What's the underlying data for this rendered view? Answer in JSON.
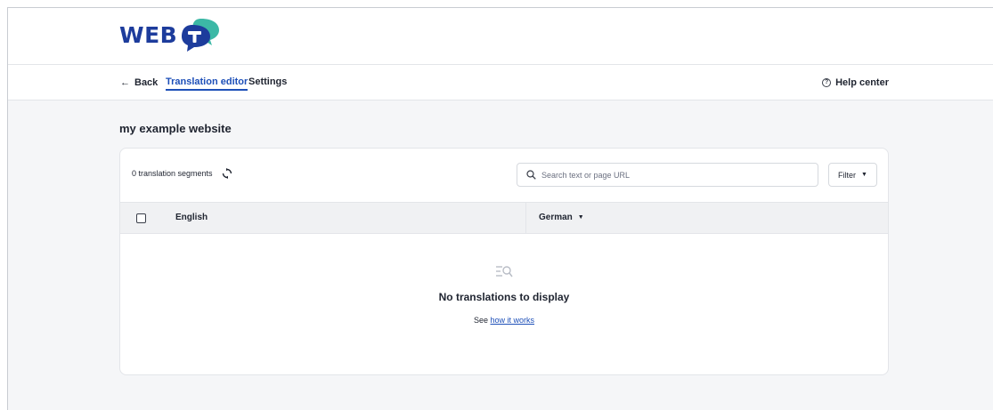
{
  "logo": {
    "text": "WEB",
    "mark_letter": "T",
    "brand_color": "#1d3c9c",
    "accent_color": "#3cb8a6"
  },
  "nav": {
    "back_label": "Back",
    "tabs": [
      {
        "label": "Translation editor",
        "active": true
      },
      {
        "label": "Settings",
        "active": false
      }
    ],
    "help_label": "Help center"
  },
  "page": {
    "title": "my example website"
  },
  "toolbar": {
    "segment_count": "0 translation segments",
    "search_placeholder": "Search text or page URL",
    "filter_label": "Filter"
  },
  "table": {
    "columns": [
      {
        "label": "English"
      },
      {
        "label": "German"
      }
    ]
  },
  "empty_state": {
    "title": "No translations to display",
    "see_text": "See",
    "link_text": "how it works"
  },
  "icons": {
    "back": "arrow-left-icon",
    "help": "help-circle-icon",
    "refresh": "refresh-icon",
    "search": "search-icon",
    "filter_caret": "caret-down-icon",
    "empty": "search-list-icon"
  }
}
